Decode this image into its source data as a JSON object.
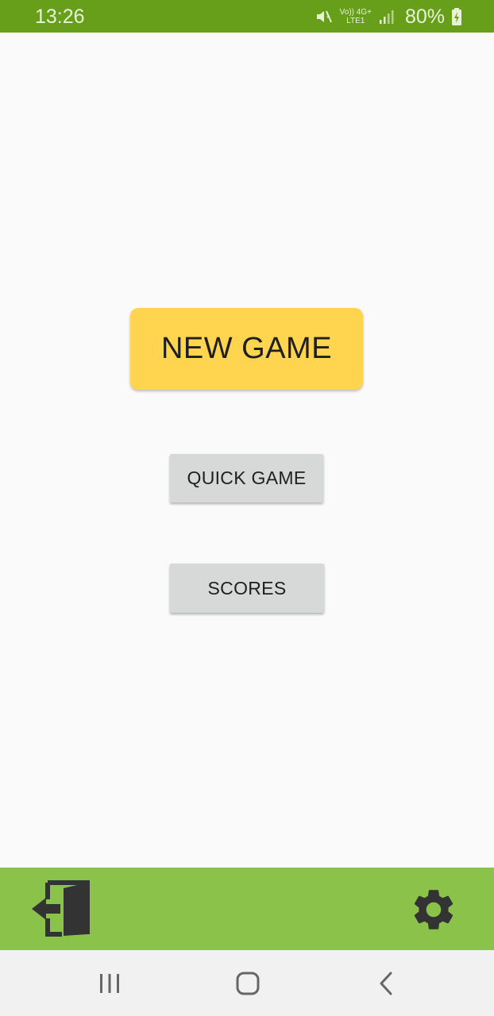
{
  "status_bar": {
    "time": "13:26",
    "network_top": "Vo)) 4G+",
    "network_bottom": "LTE1",
    "battery_percent": "80%",
    "icons": [
      "mute-icon",
      "network-type-icon",
      "signal-icon",
      "battery-charging-icon"
    ]
  },
  "main": {
    "new_game_label": "NEW GAME",
    "quick_game_label": "QUICK GAME",
    "scores_label": "SCORES"
  },
  "toolbar": {
    "exit_icon": "exit-door-icon",
    "settings_icon": "gear-icon"
  },
  "nav": {
    "recents_icon": "recents-icon",
    "home_icon": "home-icon",
    "back_icon": "back-icon"
  },
  "colors": {
    "status_bar": "#689f1a",
    "toolbar": "#8bc34a",
    "new_game_button": "#ffd54f",
    "secondary_button": "#d7d8d8",
    "background": "#fafafa"
  }
}
